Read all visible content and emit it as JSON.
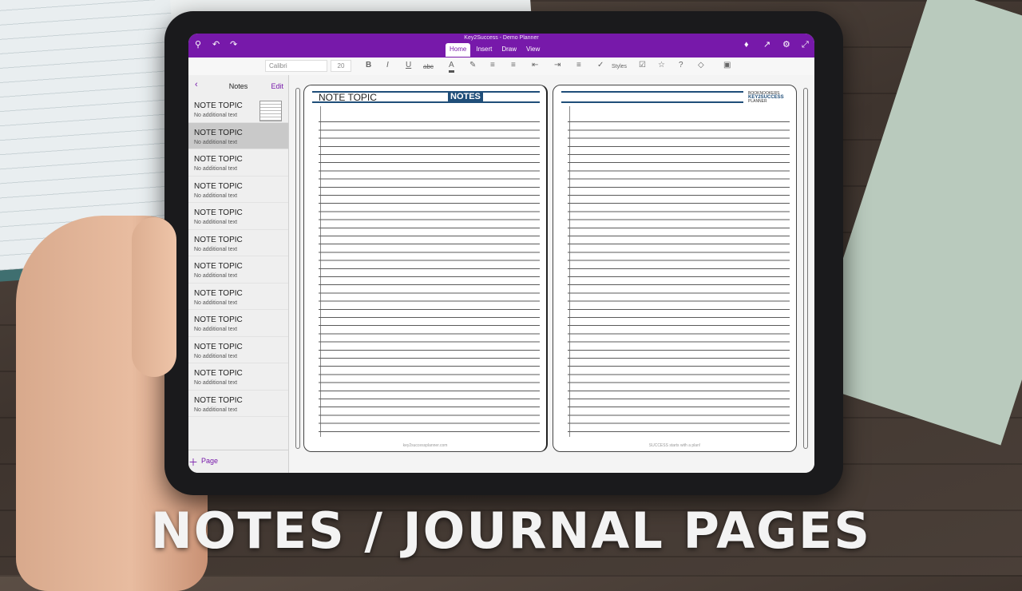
{
  "window": {
    "doc_title": "Key2Success - Demo Planner"
  },
  "tabs": [
    {
      "label": "Home",
      "active": true
    },
    {
      "label": "Insert",
      "active": false
    },
    {
      "label": "Draw",
      "active": false
    },
    {
      "label": "View",
      "active": false
    }
  ],
  "ribbon": {
    "font": "Calibri",
    "size": "20",
    "bold": "B",
    "italic": "I",
    "underline": "U",
    "strike": "abc",
    "font_color": "A",
    "styles": "Styles",
    "help": "?"
  },
  "sidebar": {
    "title": "Notes",
    "edit": "Edit",
    "add_page": "Page",
    "pages": [
      {
        "title": "NOTE TOPIC",
        "subtitle": "No additional text"
      },
      {
        "title": "NOTE TOPIC",
        "subtitle": "No additional text"
      },
      {
        "title": "NOTE TOPIC",
        "subtitle": "No additional text"
      },
      {
        "title": "NOTE TOPIC",
        "subtitle": "No additional text"
      },
      {
        "title": "NOTE TOPIC",
        "subtitle": "No additional text"
      },
      {
        "title": "NOTE TOPIC",
        "subtitle": "No additional text"
      },
      {
        "title": "NOTE TOPIC",
        "subtitle": "No additional text"
      },
      {
        "title": "NOTE TOPIC",
        "subtitle": "No additional text"
      },
      {
        "title": "NOTE TOPIC",
        "subtitle": "No additional text"
      },
      {
        "title": "NOTE TOPIC",
        "subtitle": "No additional text"
      },
      {
        "title": "NOTE TOPIC",
        "subtitle": "No additional text"
      },
      {
        "title": "NOTE TOPIC",
        "subtitle": "No additional text"
      }
    ]
  },
  "planner": {
    "topic": "NOTE TOPIC",
    "notes_label": "NOTES",
    "brand_top": "BOOKNOOKERS",
    "brand_name": "KEY2SUCCESS",
    "brand_sub": "PLANNER",
    "left_footer": "key2successplanner.com",
    "right_footer": "SUCCESS starts with a plan!"
  },
  "caption": "NOTES / JOURNAL PAGES"
}
